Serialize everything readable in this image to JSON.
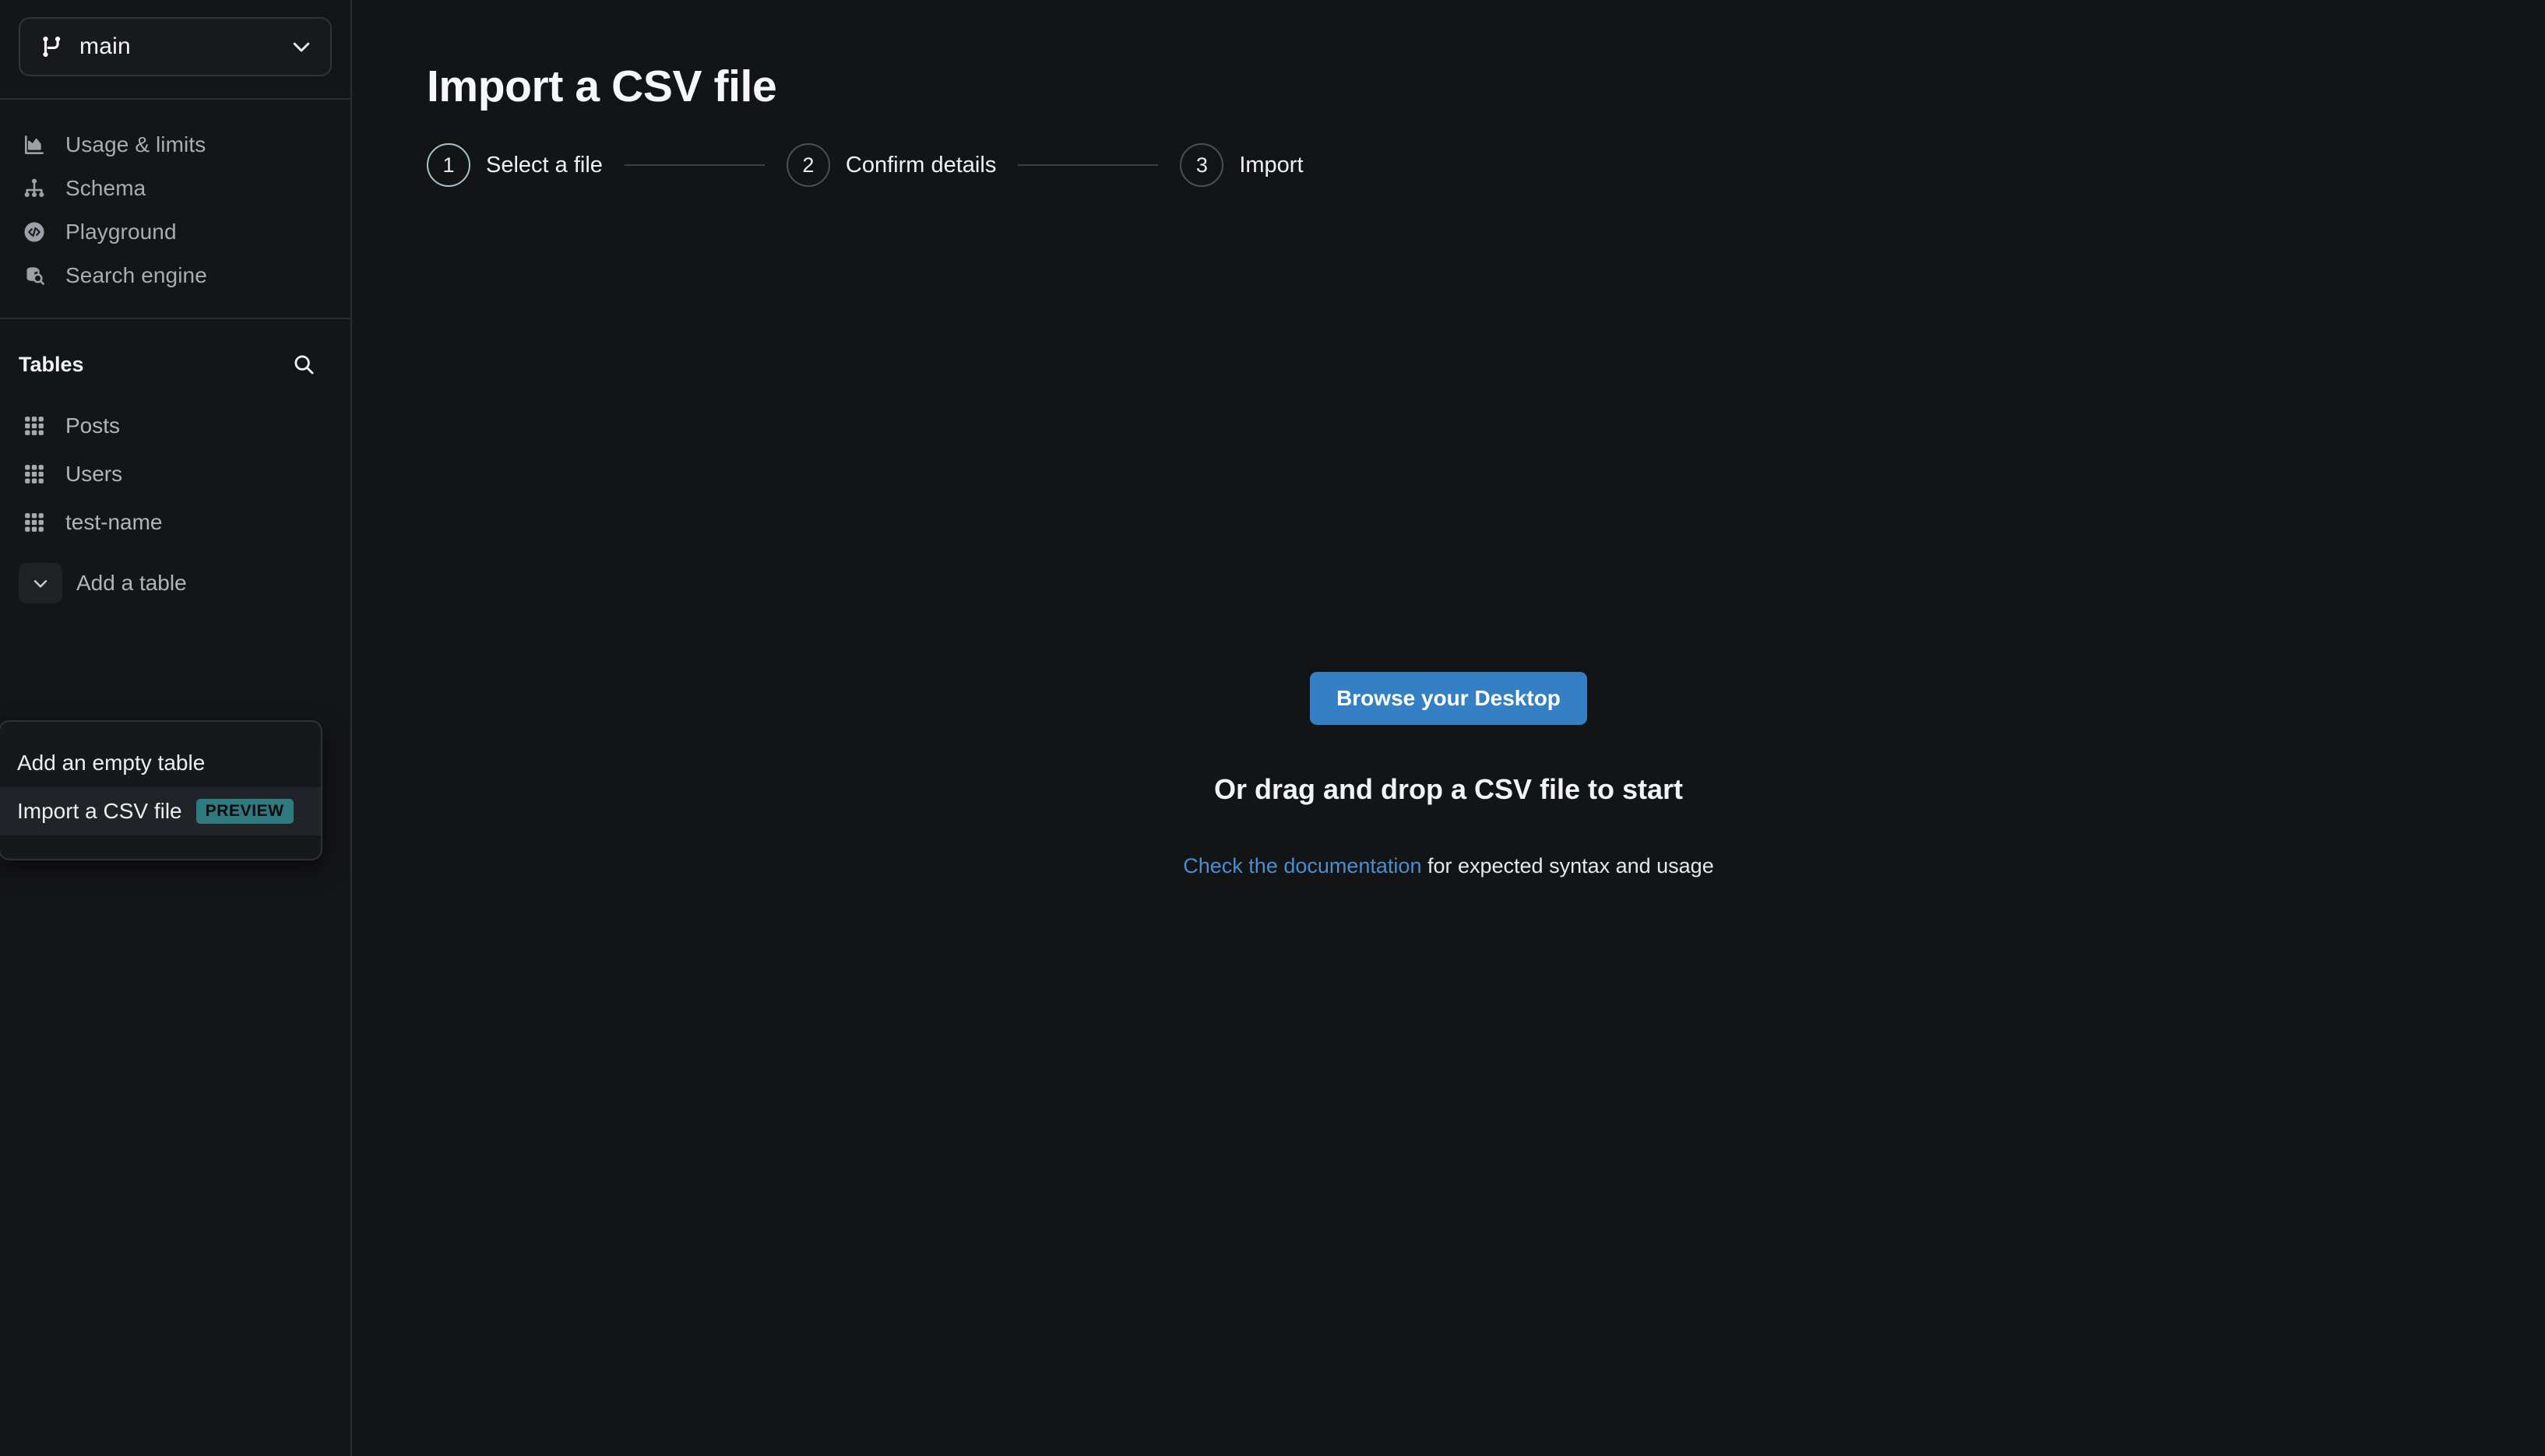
{
  "sidebar": {
    "branch": {
      "icon": "git-branch-icon",
      "label": "main",
      "chevron": "chevron-down-icon"
    },
    "nav_items": [
      {
        "icon": "chart-icon",
        "label": "Usage & limits"
      },
      {
        "icon": "schema-icon",
        "label": "Schema"
      },
      {
        "icon": "code-circle-icon",
        "label": "Playground"
      },
      {
        "icon": "database-search-icon",
        "label": "Search engine"
      }
    ],
    "tables_section": {
      "title": "Tables",
      "search_icon": "search-icon",
      "tables": [
        {
          "icon": "grid-icon",
          "label": "Posts"
        },
        {
          "icon": "grid-icon",
          "label": "Users"
        },
        {
          "icon": "grid-icon",
          "label": "test-name"
        }
      ],
      "add_table": {
        "icon": "chevron-down-icon",
        "label": "Add a table"
      }
    },
    "add_table_menu": {
      "items": [
        {
          "label": "Add an empty table",
          "badge": "",
          "active": false
        },
        {
          "label": "Import a CSV file",
          "badge": "PREVIEW",
          "active": true
        }
      ]
    }
  },
  "main": {
    "title": "Import a CSV file",
    "stepper": [
      {
        "number": "1",
        "label": "Select a file",
        "state": "current"
      },
      {
        "number": "2",
        "label": "Confirm details",
        "state": "upcoming"
      },
      {
        "number": "3",
        "label": "Import",
        "state": "upcoming"
      }
    ],
    "dropzone": {
      "browse_label": "Browse your Desktop",
      "headline": "Or drag and drop a CSV file to start",
      "doc_link_text": "Check the documentation",
      "doc_suffix": " for expected syntax and usage"
    }
  },
  "colors": {
    "background": "#131416",
    "sidebar": "#141517",
    "accent_blue": "#3580c4",
    "link_blue": "#4a8ed0",
    "badge_teal": "#2f7a80",
    "step_active_ring": "#a6c1d1",
    "divider": "#2a2c30"
  }
}
